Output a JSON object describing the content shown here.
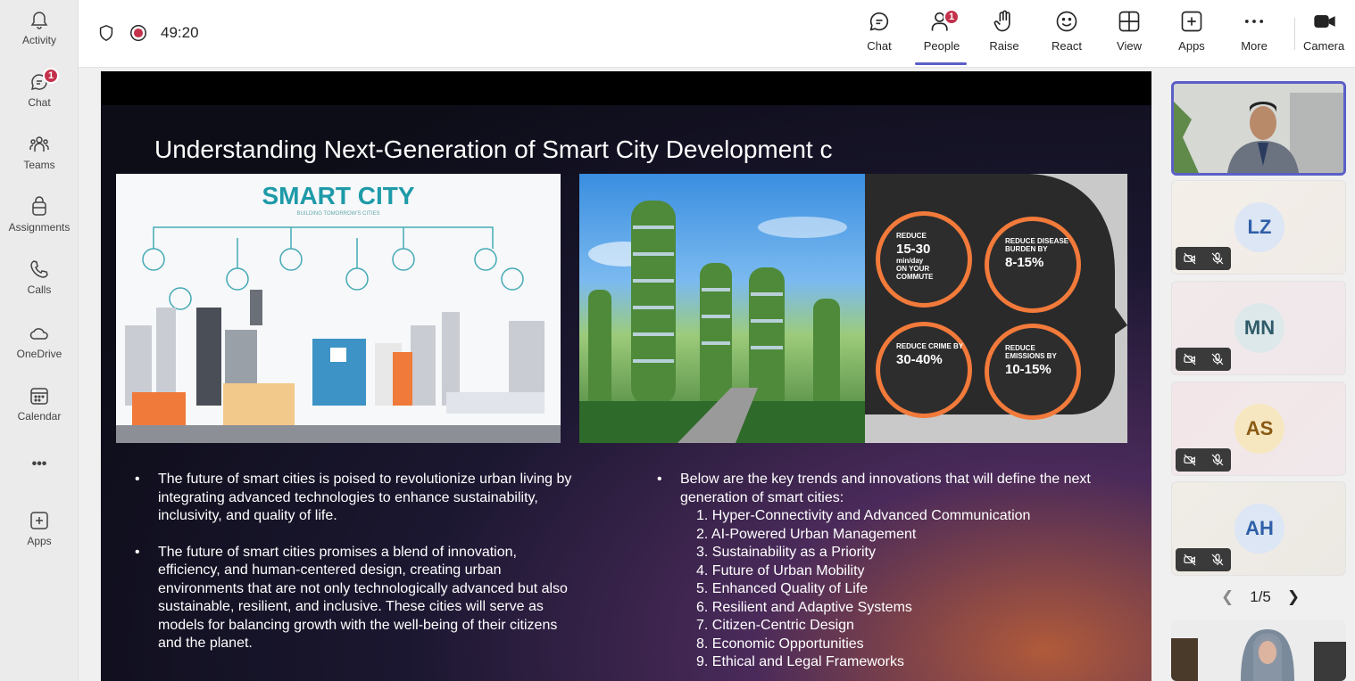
{
  "rail": {
    "items": [
      {
        "label": "Activity",
        "icon": "bell-icon"
      },
      {
        "label": "Chat",
        "icon": "chat-icon",
        "badge": "1"
      },
      {
        "label": "Teams",
        "icon": "teams-icon"
      },
      {
        "label": "Assignments",
        "icon": "assignments-icon"
      },
      {
        "label": "Calls",
        "icon": "phone-icon"
      },
      {
        "label": "OneDrive",
        "icon": "cloud-icon"
      },
      {
        "label": "Calendar",
        "icon": "calendar-icon"
      },
      {
        "label": "•••",
        "icon": "more-apps-icon"
      },
      {
        "label": "Apps",
        "icon": "add-apps-icon"
      }
    ]
  },
  "meeting": {
    "timer": "49:20",
    "toolbar": {
      "chat": "Chat",
      "people": "People",
      "people_badge": "1",
      "raise": "Raise",
      "react": "React",
      "view": "View",
      "apps": "Apps",
      "more": "More",
      "camera": "Camera"
    }
  },
  "slide": {
    "title": "Understanding Next-Generation of Smart City Development c",
    "image_left_title": "SMART CITY",
    "image_left_subtitle": "BUILDING TOMORROW'S CITIES",
    "stats": [
      {
        "label": "REDUCE",
        "value": "15-30",
        "unit": "min/day",
        "note": "ON YOUR COMMUTE"
      },
      {
        "label": "REDUCE DISEASE BURDEN BY",
        "value": "8-15%",
        "unit": "",
        "note": ""
      },
      {
        "label": "REDUCE CRIME BY",
        "value": "30-40%",
        "unit": "",
        "note": ""
      },
      {
        "label": "REDUCE EMISSIONS BY",
        "value": "10-15%",
        "unit": "",
        "note": ""
      }
    ],
    "left_bullets": [
      "The future of smart cities is poised to revolutionize urban living by integrating advanced technologies to enhance sustainability, inclusivity, and quality of life.",
      "The future of smart cities promises a blend of innovation, efficiency, and human-centered design, creating urban environments that are not only technologically advanced but also sustainable, resilient, and inclusive. These cities will serve as models for balancing growth with the well-being of their citizens and the planet."
    ],
    "right_intro": "Below are the key trends and innovations that will define the next generation of smart cities:",
    "right_list": [
      "1. Hyper-Connectivity and Advanced Communication",
      "2. AI-Powered Urban Management",
      "3. Sustainability as a Priority",
      "4. Future of Urban Mobility",
      "5. Enhanced Quality of Life",
      "6. Resilient and Adaptive Systems",
      "7. Citizen-Centric Design",
      "8. Economic Opportunities",
      "9. Ethical and Legal Frameworks"
    ]
  },
  "participants": {
    "avatars": [
      {
        "initials": "LZ",
        "bg": "#dce6f4",
        "fg": "#2f5fa8"
      },
      {
        "initials": "MN",
        "bg": "#dde8ea",
        "fg": "#2f5b6a"
      },
      {
        "initials": "AS",
        "bg": "#f6e7c1",
        "fg": "#8a5a13"
      },
      {
        "initials": "AH",
        "bg": "#dce6f4",
        "fg": "#2f5fa8"
      }
    ],
    "pager": "1/5"
  }
}
